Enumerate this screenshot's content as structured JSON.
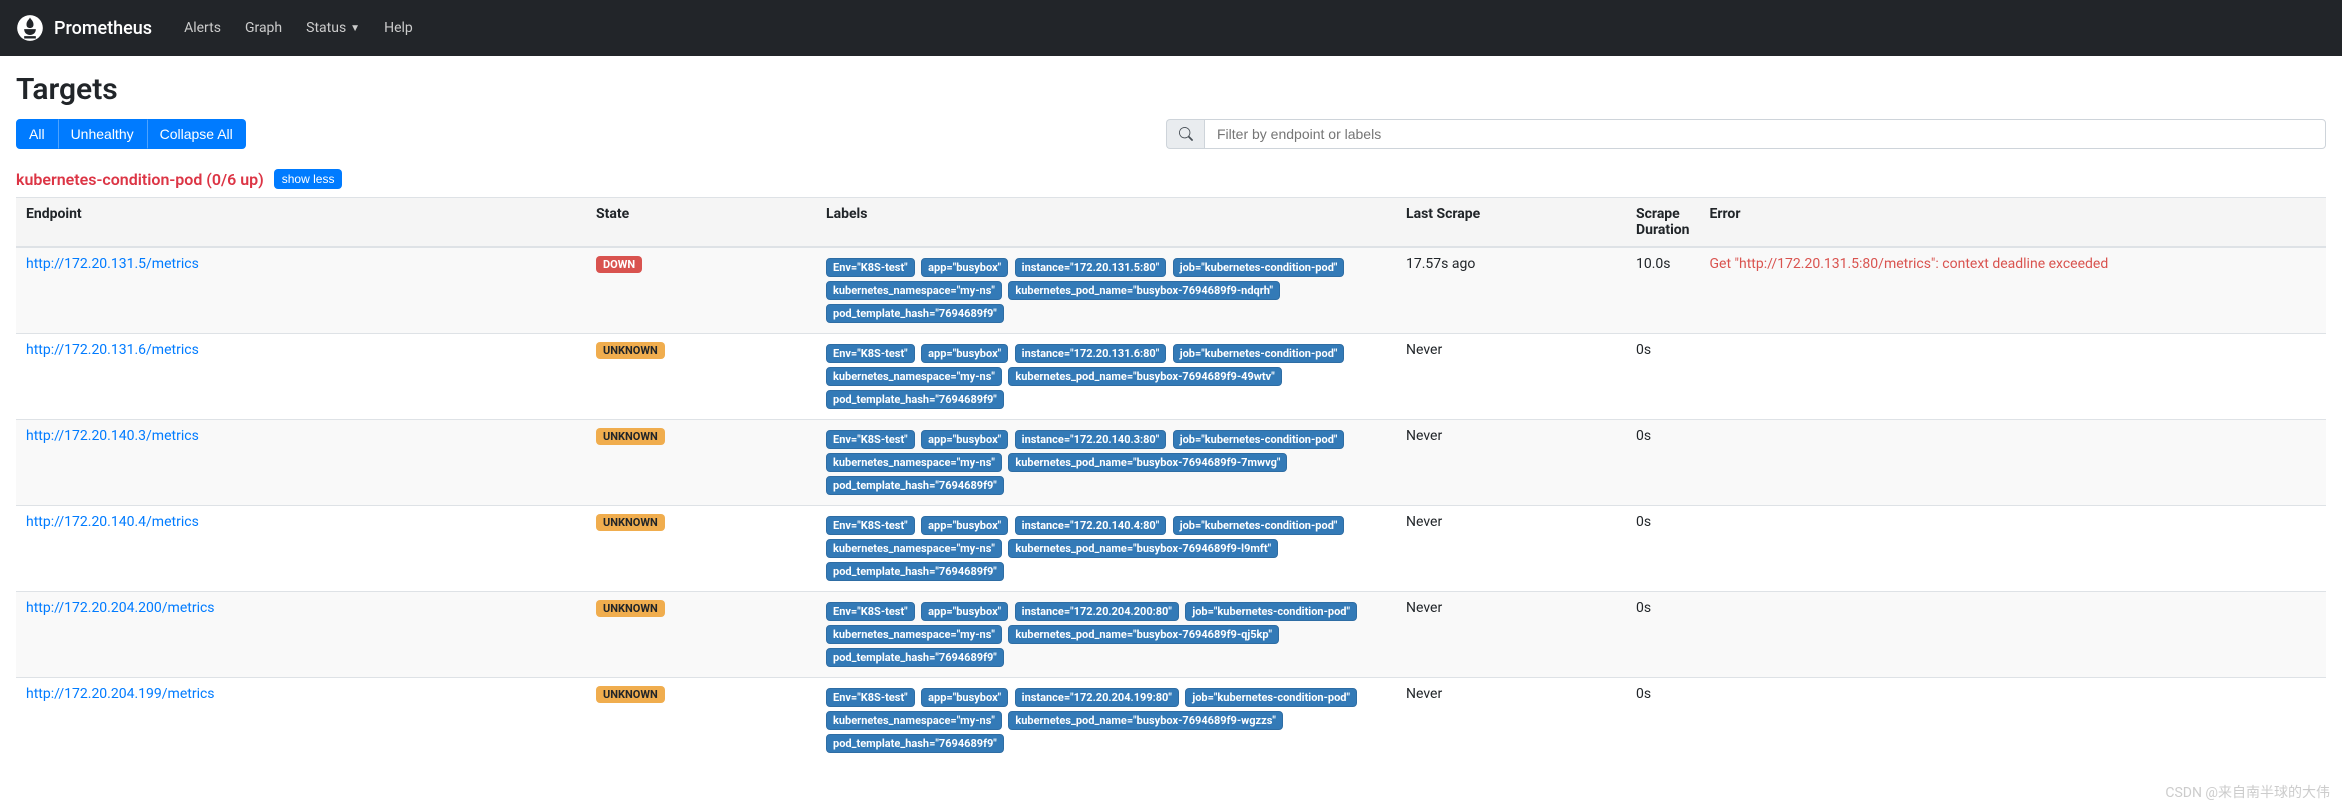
{
  "navbar": {
    "brand": "Prometheus",
    "links": [
      "Alerts",
      "Graph",
      "Status",
      "Help"
    ]
  },
  "page": {
    "title": "Targets",
    "buttons": {
      "all": "All",
      "unhealthy": "Unhealthy",
      "collapse": "Collapse All"
    },
    "search_placeholder": "Filter by endpoint or labels"
  },
  "pool": {
    "title": "kubernetes-condition-pod (0/6 up)",
    "show_label": "show less"
  },
  "columns": {
    "endpoint": "Endpoint",
    "state": "State",
    "labels": "Labels",
    "last_scrape": "Last Scrape",
    "duration": "Scrape Duration",
    "error": "Error"
  },
  "rows": [
    {
      "endpoint": "http://172.20.131.5/metrics",
      "state": "DOWN",
      "state_class": "badge-down",
      "labels": [
        "Env=\"K8S-test\"",
        "app=\"busybox\"",
        "instance=\"172.20.131.5:80\"",
        "job=\"kubernetes-condition-pod\"",
        "kubernetes_namespace=\"my-ns\"",
        "kubernetes_pod_name=\"busybox-7694689f9-ndqrh\"",
        "pod_template_hash=\"7694689f9\""
      ],
      "last_scrape": "17.57s ago",
      "duration": "10.0s",
      "error": "Get \"http://172.20.131.5:80/metrics\": context deadline exceeded"
    },
    {
      "endpoint": "http://172.20.131.6/metrics",
      "state": "UNKNOWN",
      "state_class": "badge-unknown",
      "labels": [
        "Env=\"K8S-test\"",
        "app=\"busybox\"",
        "instance=\"172.20.131.6:80\"",
        "job=\"kubernetes-condition-pod\"",
        "kubernetes_namespace=\"my-ns\"",
        "kubernetes_pod_name=\"busybox-7694689f9-49wtv\"",
        "pod_template_hash=\"7694689f9\""
      ],
      "last_scrape": "Never",
      "duration": "0s",
      "error": ""
    },
    {
      "endpoint": "http://172.20.140.3/metrics",
      "state": "UNKNOWN",
      "state_class": "badge-unknown",
      "labels": [
        "Env=\"K8S-test\"",
        "app=\"busybox\"",
        "instance=\"172.20.140.3:80\"",
        "job=\"kubernetes-condition-pod\"",
        "kubernetes_namespace=\"my-ns\"",
        "kubernetes_pod_name=\"busybox-7694689f9-7mwvg\"",
        "pod_template_hash=\"7694689f9\""
      ],
      "last_scrape": "Never",
      "duration": "0s",
      "error": ""
    },
    {
      "endpoint": "http://172.20.140.4/metrics",
      "state": "UNKNOWN",
      "state_class": "badge-unknown",
      "labels": [
        "Env=\"K8S-test\"",
        "app=\"busybox\"",
        "instance=\"172.20.140.4:80\"",
        "job=\"kubernetes-condition-pod\"",
        "kubernetes_namespace=\"my-ns\"",
        "kubernetes_pod_name=\"busybox-7694689f9-l9mft\"",
        "pod_template_hash=\"7694689f9\""
      ],
      "last_scrape": "Never",
      "duration": "0s",
      "error": ""
    },
    {
      "endpoint": "http://172.20.204.200/metrics",
      "state": "UNKNOWN",
      "state_class": "badge-unknown",
      "labels": [
        "Env=\"K8S-test\"",
        "app=\"busybox\"",
        "instance=\"172.20.204.200:80\"",
        "job=\"kubernetes-condition-pod\"",
        "kubernetes_namespace=\"my-ns\"",
        "kubernetes_pod_name=\"busybox-7694689f9-qj5kp\"",
        "pod_template_hash=\"7694689f9\""
      ],
      "last_scrape": "Never",
      "duration": "0s",
      "error": ""
    },
    {
      "endpoint": "http://172.20.204.199/metrics",
      "state": "UNKNOWN",
      "state_class": "badge-unknown",
      "labels": [
        "Env=\"K8S-test\"",
        "app=\"busybox\"",
        "instance=\"172.20.204.199:80\"",
        "job=\"kubernetes-condition-pod\"",
        "kubernetes_namespace=\"my-ns\"",
        "kubernetes_pod_name=\"busybox-7694689f9-wgzzs\"",
        "pod_template_hash=\"7694689f9\""
      ],
      "last_scrape": "Never",
      "duration": "0s",
      "error": ""
    }
  ],
  "watermark": "CSDN @来自南半球的大伟"
}
